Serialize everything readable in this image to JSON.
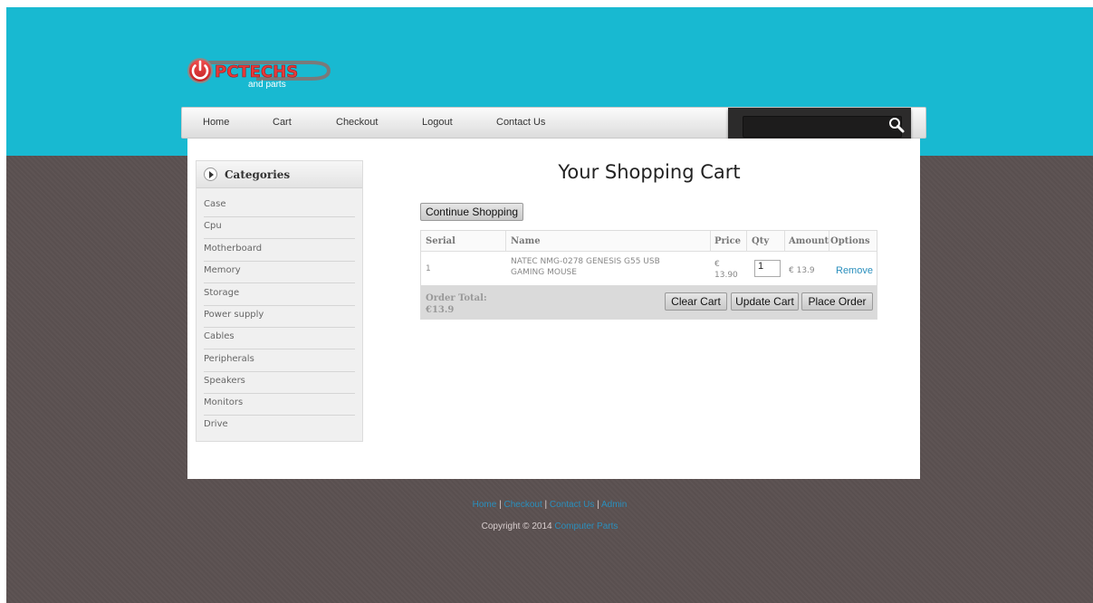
{
  "brand": {
    "logo_main": "PCTECHS",
    "logo_sub": "and parts"
  },
  "nav": {
    "items": [
      "Home",
      "Cart",
      "Checkout",
      "Logout",
      "Contact Us"
    ]
  },
  "search": {
    "placeholder": ""
  },
  "sidebar": {
    "title": "Categories",
    "items": [
      "Case",
      "Cpu",
      "Motherboard",
      "Memory",
      "Storage",
      "Power supply",
      "Cables",
      "Peripherals",
      "Speakers",
      "Monitors",
      "Drive"
    ]
  },
  "main": {
    "title": "Your Shopping Cart",
    "continue_label": "Continue Shopping"
  },
  "cart": {
    "headers": [
      "Serial",
      "Name",
      "Price",
      "Qty",
      "Amount",
      "Options"
    ],
    "rows": [
      {
        "serial": "1",
        "name_line1": "NATEC NMG-0278 GENESIS G55 USB",
        "name_line2": "GAMING MOUSE",
        "price_currency": "€",
        "price_value": "13.90",
        "qty": "1",
        "amount": "€ 13.9",
        "option": "Remove"
      }
    ],
    "total_label": "Order Total:",
    "total_value": "€13.9",
    "buttons": {
      "clear": "Clear Cart",
      "update": "Update Cart",
      "place": "Place Order"
    }
  },
  "footer": {
    "links": [
      "Home",
      "Checkout",
      "Contact Us",
      "Admin"
    ],
    "separator": "|",
    "copyright": "Copyright © 2014",
    "copyright_brand": "Computer Parts"
  },
  "colors": {
    "accent": "#18b9d1",
    "background": "#5b5151",
    "link": "#2a8fbd"
  }
}
